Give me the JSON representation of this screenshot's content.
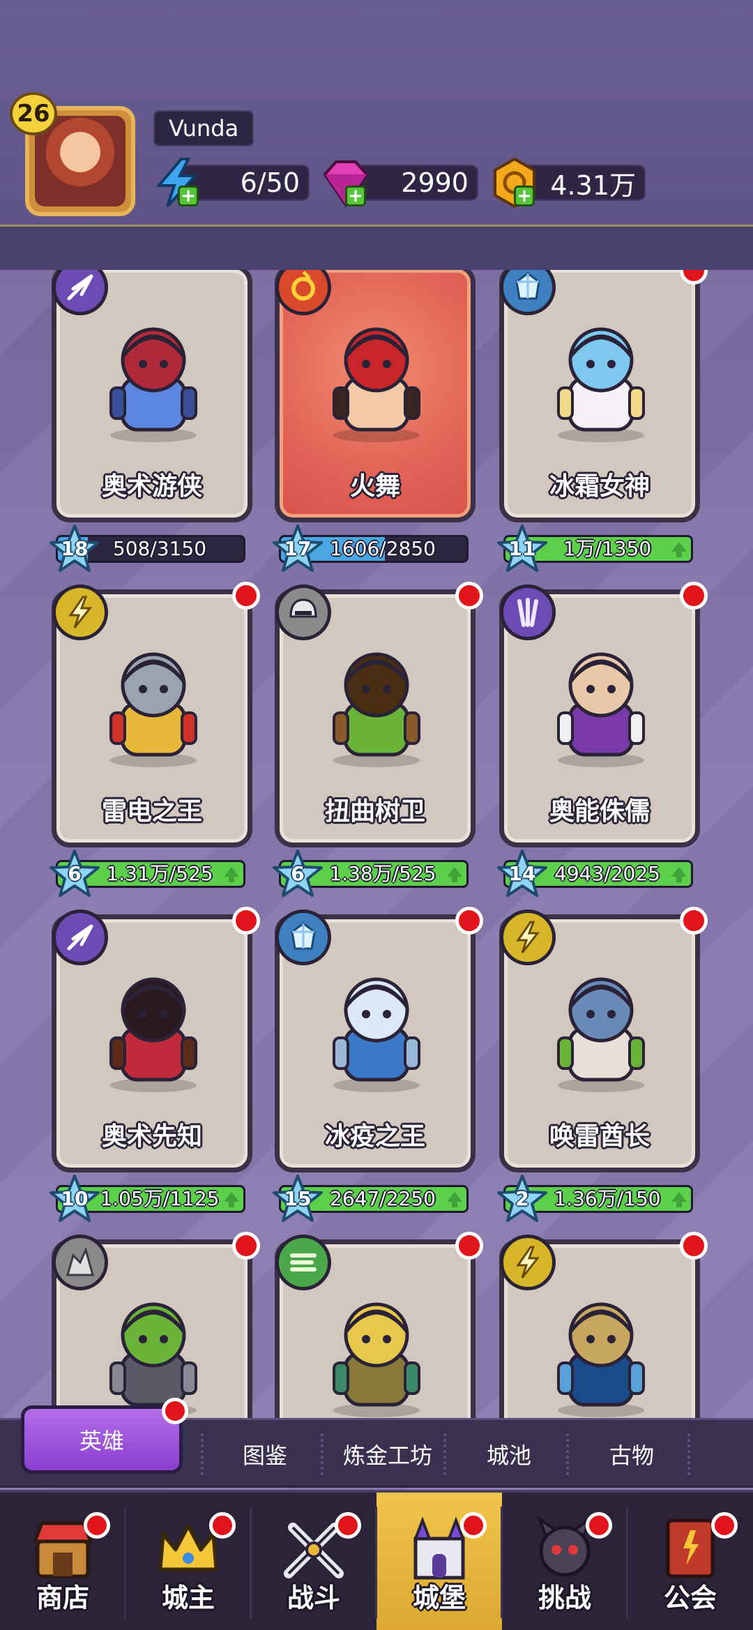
{
  "player": {
    "level": "26",
    "name": "Vunda"
  },
  "resources": {
    "energy": "6/50",
    "gems": "2990",
    "gold": "4.31万"
  },
  "heroes": [
    {
      "name": "奥术游侠",
      "stars": "18",
      "progress": "508/3150",
      "fill": 0.16,
      "upgrade": false,
      "dot": false,
      "selected": false,
      "class_color": "#6c4bb5",
      "class_icon": "arrows-icon"
    },
    {
      "name": "火舞",
      "stars": "17",
      "progress": "1606/2850",
      "fill": 0.56,
      "upgrade": false,
      "dot": false,
      "selected": true,
      "class_color": "#d84a2a",
      "class_icon": "fire-ring-icon"
    },
    {
      "name": "冰霜女神",
      "stars": "11",
      "progress": "1万/1350",
      "fill": 1.0,
      "upgrade": true,
      "dot": true,
      "selected": false,
      "class_color": "#3f80c0",
      "class_icon": "ice-crystal-icon"
    },
    {
      "name": "雷电之王",
      "stars": "6",
      "progress": "1.31万/525",
      "fill": 1.0,
      "upgrade": true,
      "dot": true,
      "selected": false,
      "class_color": "#d8b62a",
      "class_icon": "lightning-icon"
    },
    {
      "name": "扭曲树卫",
      "stars": "6",
      "progress": "1.38万/525",
      "fill": 1.0,
      "upgrade": true,
      "dot": true,
      "selected": false,
      "class_color": "#8a8a8a",
      "class_icon": "helmet-icon"
    },
    {
      "name": "奥能侏儒",
      "stars": "14",
      "progress": "4943/2025",
      "fill": 1.0,
      "upgrade": true,
      "dot": true,
      "selected": false,
      "class_color": "#6c4bb5",
      "class_icon": "arcane-claw-icon"
    },
    {
      "name": "奥术先知",
      "stars": "10",
      "progress": "1.05万/1125",
      "fill": 1.0,
      "upgrade": true,
      "dot": true,
      "selected": false,
      "class_color": "#6c4bb5",
      "class_icon": "arrows-icon"
    },
    {
      "name": "冰疫之王",
      "stars": "15",
      "progress": "2647/2250",
      "fill": 1.0,
      "upgrade": true,
      "dot": true,
      "selected": false,
      "class_color": "#3f80c0",
      "class_icon": "ice-crystal-icon"
    },
    {
      "name": "唤雷酋长",
      "stars": "2",
      "progress": "1.36万/150",
      "fill": 1.0,
      "upgrade": true,
      "dot": true,
      "selected": false,
      "class_color": "#d8b62a",
      "class_icon": "lightning-icon"
    },
    {
      "name": "",
      "stars": "",
      "progress": "",
      "fill": 0,
      "upgrade": false,
      "dot": true,
      "selected": false,
      "class_color": "#8a8a8a",
      "class_icon": "rock-icon"
    },
    {
      "name": "",
      "stars": "",
      "progress": "",
      "fill": 0,
      "upgrade": false,
      "dot": true,
      "selected": false,
      "class_color": "#4aa84a",
      "class_icon": "wind-icon"
    },
    {
      "name": "",
      "stars": "",
      "progress": "",
      "fill": 0,
      "upgrade": false,
      "dot": true,
      "selected": false,
      "class_color": "#d8b62a",
      "class_icon": "lightning-icon"
    }
  ],
  "subtabs": {
    "active": "英雄",
    "items": [
      "图鉴",
      "炼金工坊",
      "城池",
      "古物"
    ]
  },
  "nav": [
    {
      "label": "商店",
      "icon": "shop-icon",
      "active": false
    },
    {
      "label": "城主",
      "icon": "crown-icon",
      "active": false
    },
    {
      "label": "战斗",
      "icon": "swords-icon",
      "active": false
    },
    {
      "label": "城堡",
      "icon": "castle-icon",
      "active": true
    },
    {
      "label": "挑战",
      "icon": "demon-icon",
      "active": false
    },
    {
      "label": "公会",
      "icon": "guild-book-icon",
      "active": false
    }
  ],
  "colors": {
    "progress_blue": "#4aa6e0",
    "progress_green": "#5cd04a",
    "alert_red": "#e0141a",
    "active_tab": "#9a4fdb",
    "active_nav": "#e8b83c"
  }
}
